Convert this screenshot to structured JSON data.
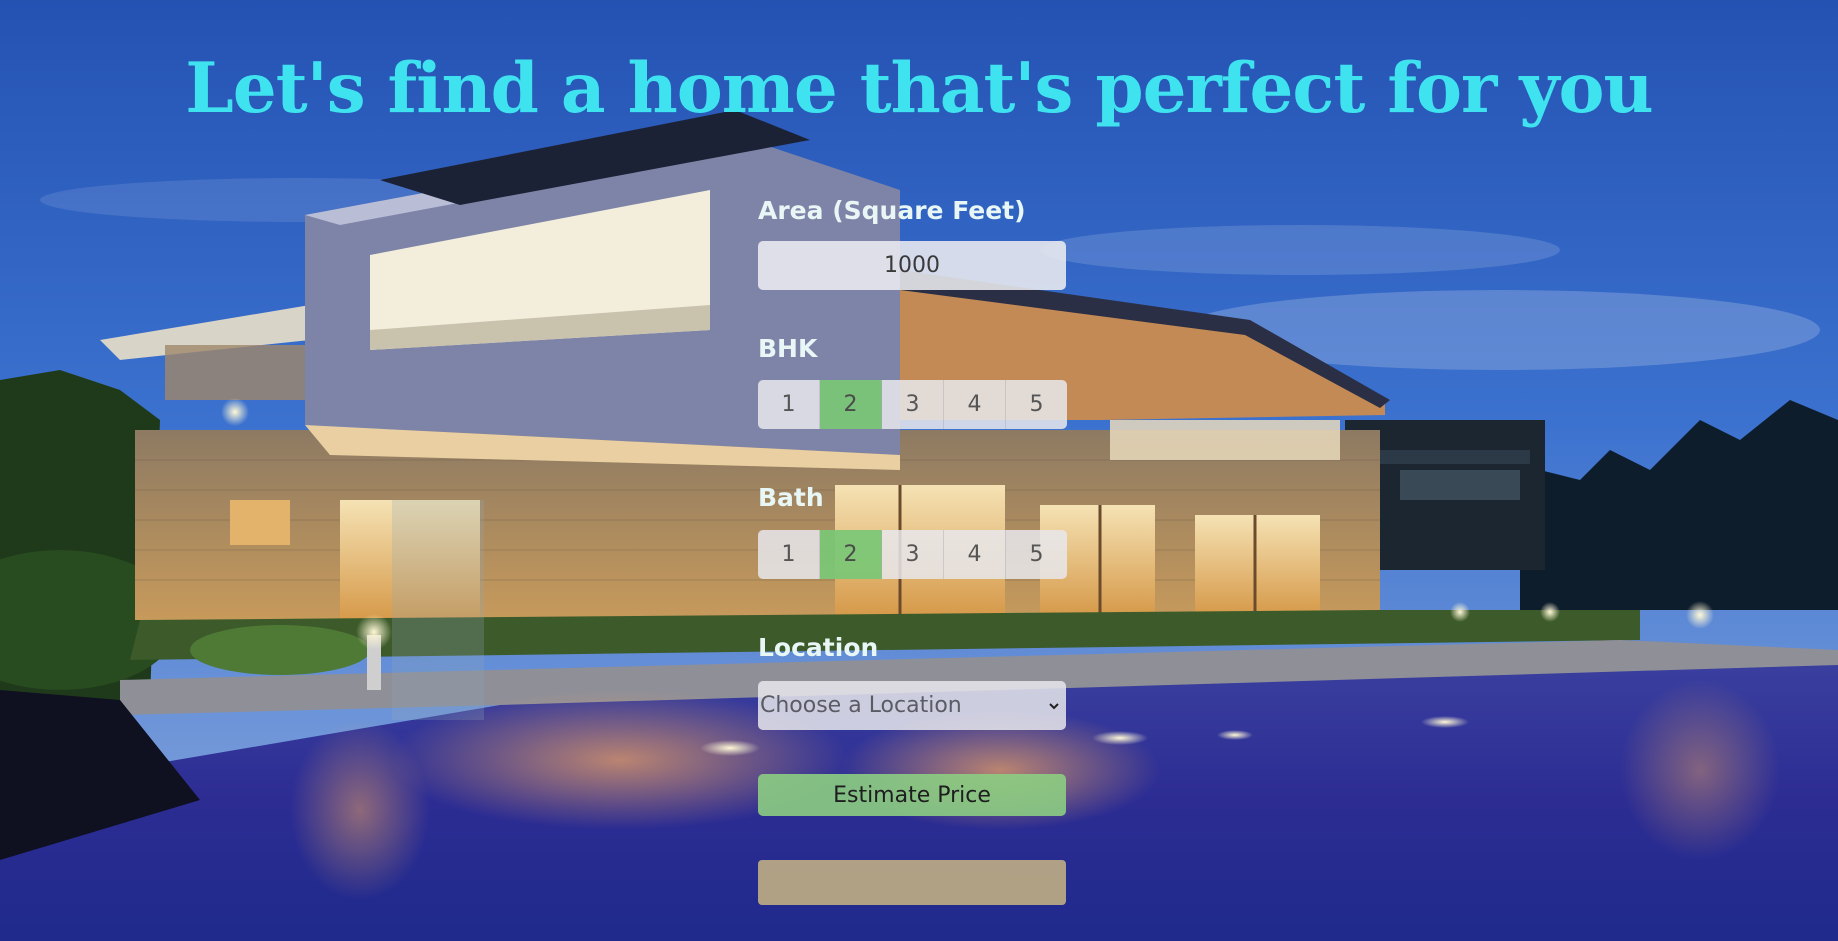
{
  "headline": "Let's find a home that's perfect for you",
  "form": {
    "area": {
      "label": "Area (Square Feet)",
      "value": "1000"
    },
    "bhk": {
      "label": "BHK",
      "options": [
        "1",
        "2",
        "3",
        "4",
        "5"
      ],
      "selected": "2"
    },
    "bath": {
      "label": "Bath",
      "options": [
        "1",
        "2",
        "3",
        "4",
        "5"
      ],
      "selected": "2"
    },
    "location": {
      "label": "Location",
      "selected": "Choose a Location",
      "icon": "chevron-down-icon"
    },
    "estimate_button": "Estimate Price",
    "result": ""
  },
  "colors": {
    "headline": "#3fe3f0",
    "active_option": "#7ac876",
    "button": "#8ccd82",
    "result_box": "#c4b284",
    "sky": "#2f5fb8"
  }
}
